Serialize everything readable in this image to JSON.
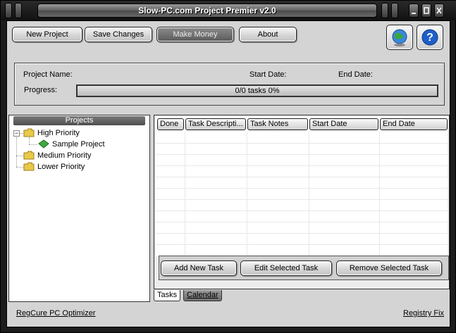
{
  "window": {
    "title": "Slow-PC.com Project Premier v2.0"
  },
  "toolbar": {
    "new_project": "New Project",
    "save_changes": "Save Changes",
    "make_money": "Make Money",
    "about": "About"
  },
  "icons": {
    "web": "globe-icon",
    "help": "help-icon"
  },
  "project_info": {
    "name_label": "Project Name:",
    "start_label": "Start Date:",
    "end_label": "End Date:",
    "progress_label": "Progress:",
    "progress_text": "0/0 tasks  0%",
    "progress_value": 0
  },
  "projects": {
    "header": "Projects",
    "tree": [
      {
        "label": "High Priority",
        "children": [
          "Sample Project"
        ]
      },
      {
        "label": "Medium Priority"
      },
      {
        "label": "Lower Priority"
      }
    ]
  },
  "tasks": {
    "columns": [
      "Done",
      "Task Descripti...",
      "Task Notes",
      "Start Date",
      "End Date"
    ],
    "rows": [],
    "add": "Add New Task",
    "edit": "Edit Selected Task",
    "remove": "Remove Selected Task"
  },
  "tabs": [
    "Tasks",
    "Calendar"
  ],
  "footer": {
    "left_link": "RegCure PC Optimizer",
    "right_link": "Registry Fix"
  },
  "colors": {
    "folder": "#e8c94a",
    "project": "#3fa83f",
    "accent": "#4a4a4a"
  }
}
